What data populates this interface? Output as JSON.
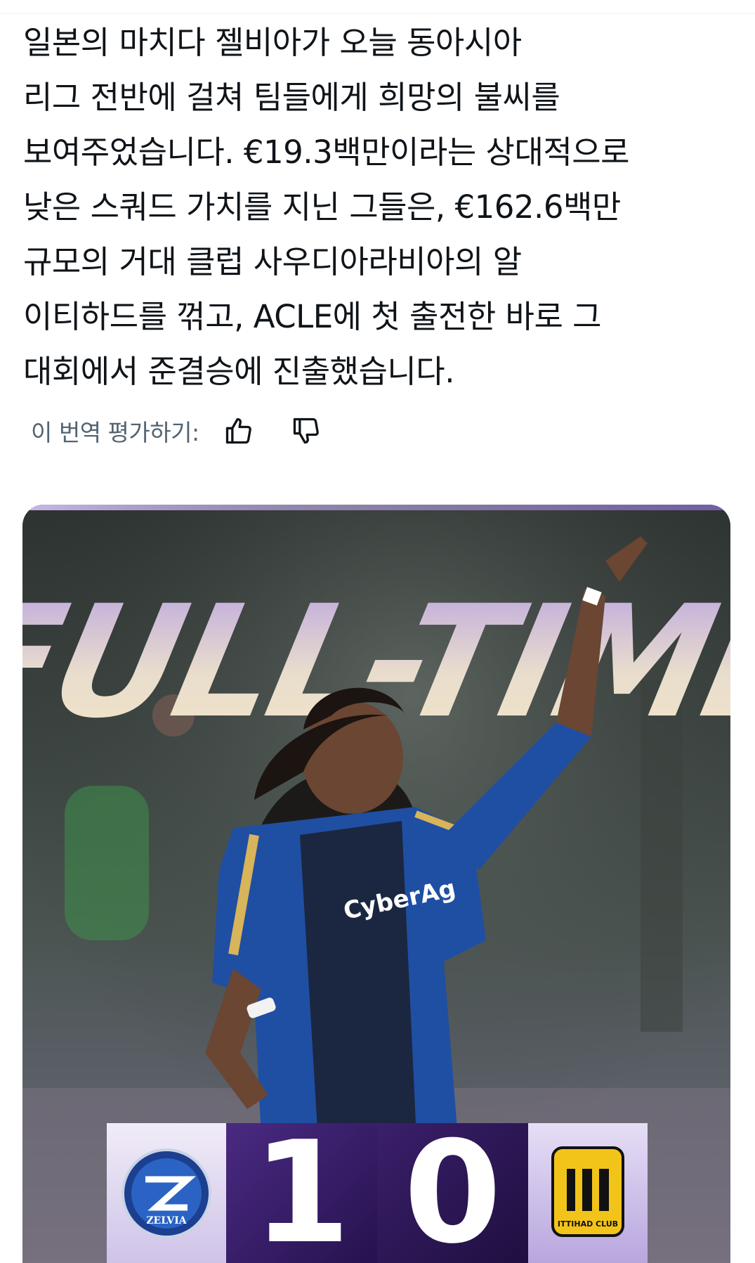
{
  "tweet": {
    "lines": [
      "일본의 마치다 젤비아가 오늘 동아시아",
      "리그 전반에 걸쳐 팀들에게 희망의 불씨를",
      "보여주었습니다. €19.3백만이라는 상대적으로",
      "낮은 스쿼드 가치를 지닌 그들은, €162.6백만",
      "규모의 거대 클럽 사우디아라비아의 알",
      "이티하드를 꺾고, ACLE에 첫 출전한 바로 그",
      "대회에서 준결승에 진출했습니다."
    ]
  },
  "translation_rating": {
    "label": "이 번역 평가하기:",
    "up_icon": "thumbs-up-icon",
    "down_icon": "thumbs-down-icon"
  },
  "media": {
    "headline": "FULL-TIME",
    "score_home": "1",
    "score_away": "0",
    "home_crest_text": "ZELVIA",
    "away_crest_text": "ITTIHAD CLUB",
    "colors": {
      "headline_light": "#f3e6c6",
      "headline_purple": "#b8a2e0",
      "score_bg": "#2a1456",
      "kit_blue": "#1f4fa3",
      "kit_gold": "#d8b45a"
    }
  }
}
